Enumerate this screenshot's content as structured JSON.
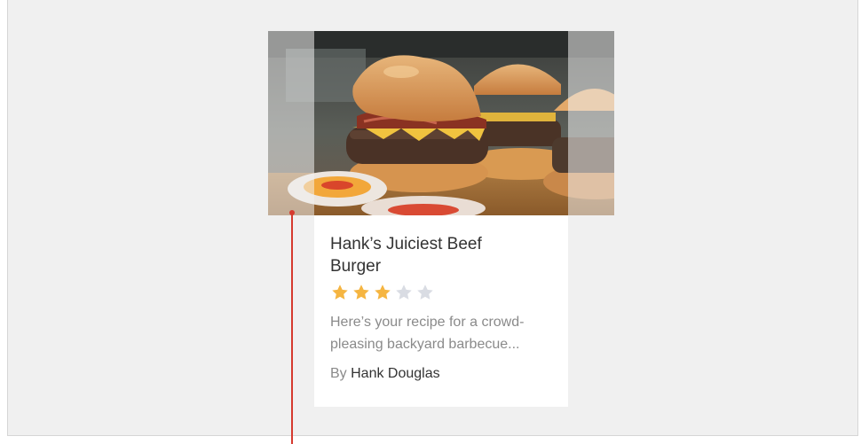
{
  "card": {
    "title": "Hank’s Juiciest Beef Burger",
    "rating": 3,
    "rating_max": 5,
    "description": "Here’s your recipe for a crowd-pleasing backyard barbecue...",
    "byline_prefix": "By",
    "author": "Hank Douglas"
  },
  "colors": {
    "stage_bg": "#f0f0f0",
    "star_filled": "#f5b541",
    "star_empty": "#d9dce3",
    "marker": "#d63a2f",
    "title_text": "#333333",
    "muted_text": "#8a8a8a"
  },
  "icons": {
    "photo": "burger-photo",
    "star": "star-icon"
  }
}
